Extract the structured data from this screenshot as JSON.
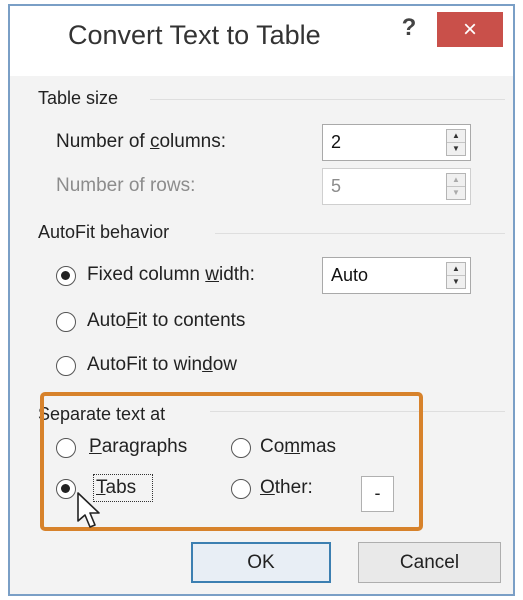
{
  "dialog": {
    "title": "Convert Text to Table",
    "help": "?",
    "close": "×"
  },
  "table_size": {
    "label": "Table size",
    "columns_label_pre": "Number of ",
    "columns_label_u": "c",
    "columns_label_post": "olumns:",
    "columns_value": "2",
    "rows_label": "Number of rows:",
    "rows_value": "5"
  },
  "autofit": {
    "label": "AutoFit behavior",
    "fixed_pre": "Fixed column ",
    "fixed_u": "w",
    "fixed_post": "idth:",
    "fixed_value": "Auto",
    "contents_pre": "Auto",
    "contents_u": "F",
    "contents_post": "it to contents",
    "window_pre": "AutoFit to win",
    "window_u": "d",
    "window_post": "ow"
  },
  "separate": {
    "label": "Separate text at",
    "paragraphs_u": "P",
    "paragraphs_post": "aragraphs",
    "commas_pre": "Co",
    "commas_u": "m",
    "commas_post": "mas",
    "tabs_u": "T",
    "tabs_post": "abs",
    "other_u": "O",
    "other_post": "ther:",
    "other_value": "-"
  },
  "buttons": {
    "ok": "OK",
    "cancel": "Cancel"
  }
}
